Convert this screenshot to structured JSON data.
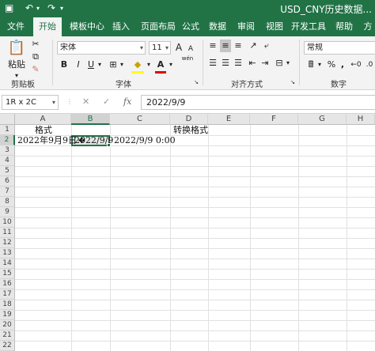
{
  "window": {
    "title": "USD_CNY历史数据..."
  },
  "quick_access": {
    "save_icon": "save-icon",
    "undo_icon": "undo-icon",
    "redo_icon": "redo-icon"
  },
  "tabs": [
    "文件",
    "开始",
    "模板中心",
    "插入",
    "页面布局",
    "公式",
    "数据",
    "审阅",
    "视图",
    "开发工具",
    "帮助",
    "方"
  ],
  "active_tab": "开始",
  "ribbon": {
    "clipboard": {
      "paste_label": "粘贴",
      "group_label": "剪贴板"
    },
    "font": {
      "font_name": "宋体",
      "font_size": "11",
      "bold": "B",
      "italic": "I",
      "underline": "U",
      "increase_font": "A",
      "decrease_font": "A",
      "font_color": "A",
      "wen": "wén",
      "group_label": "字体"
    },
    "alignment": {
      "group_label": "对齐方式"
    },
    "number": {
      "format": "常规",
      "percent": "%",
      "comma": ",",
      "group_label": "数字"
    }
  },
  "formula_bar": {
    "name_box": "1R x 2C",
    "fx": "fx",
    "value": "2022/9/9"
  },
  "columns": [
    "A",
    "B",
    "C",
    "D",
    "E",
    "F",
    "G",
    "H"
  ],
  "rows": [
    "1",
    "2",
    "3",
    "4",
    "5",
    "6",
    "7",
    "8",
    "9",
    "10",
    "11",
    "12",
    "13",
    "14",
    "15",
    "16",
    "17",
    "18",
    "19",
    "20",
    "21",
    "22"
  ],
  "cells": {
    "A1": "格式",
    "D1": "转换格式",
    "A2": "2022年9月9日",
    "B2": "2022/9/9",
    "C2": "2022/9/9 0:00"
  },
  "colors": {
    "accent": "#217346"
  }
}
